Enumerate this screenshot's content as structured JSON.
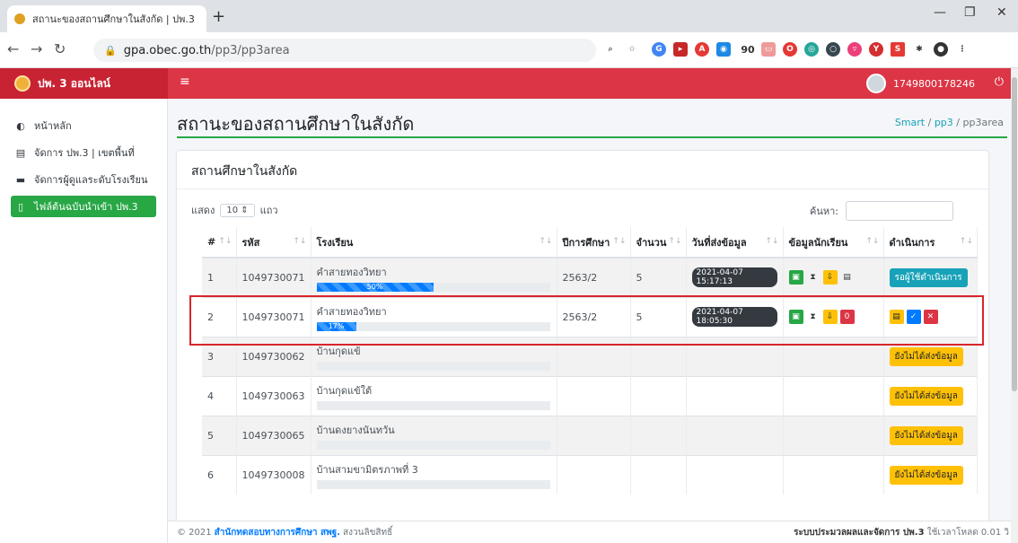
{
  "browser": {
    "tab_title": "สถานะของสถานศึกษาในสังกัด | ปพ.3 ×",
    "url_host": "gpa.obec.go.th",
    "url_path": "/pp3/pp3area",
    "badge_count": "90"
  },
  "header": {
    "brand": "ปพ. 3 ออนไลน์",
    "user_id": "1749800178246"
  },
  "sidebar": {
    "items": [
      {
        "label": "หน้าหลัก"
      },
      {
        "label": "จัดการ ปพ.3 | เขตพื้นที่"
      },
      {
        "label": "จัดการผู้ดูแลระดับโรงเรียน"
      },
      {
        "label": "ไฟล์ต้นฉบับนำเข้า ปพ.3"
      }
    ]
  },
  "page": {
    "title": "สถานะของสถานศึกษาในสังกัด",
    "breadcrumb": [
      "Smart",
      "pp3",
      "pp3area"
    ]
  },
  "card": {
    "title": "สถานศึกษาในสังกัด",
    "length_prefix": "แสดง",
    "length_value": "10",
    "length_suffix": "แถว",
    "search_label": "ค้นหา:"
  },
  "table": {
    "columns": [
      "#",
      "รหัส",
      "โรงเรียน",
      "ปีการศึกษา",
      "จำนวน",
      "วันที่ส่งข้อมูล",
      "ข้อมูลนักเรียน",
      "ดำเนินการ"
    ],
    "rows": [
      {
        "no": "1",
        "code": "1049730071",
        "school": "คำสายทองวิทยา",
        "progress_label": "50%",
        "progress": 0.5,
        "year": "2563/2",
        "count": "5",
        "date": "2021-04-07 15:17:13",
        "action": "รอผู้ใช้ดำเนินการ"
      },
      {
        "no": "2",
        "code": "1049730071",
        "school": "คำสายทองวิทยา",
        "progress_label": "17%",
        "progress": 0.17,
        "year": "2563/2",
        "count": "5",
        "date": "2021-04-07 18:05:30",
        "action": "",
        "count_badge": "0"
      },
      {
        "no": "3",
        "code": "1049730062",
        "school": "บ้านกุดแข้",
        "progress": 0,
        "year": "",
        "count": "",
        "date": "",
        "action": "ยังไม่ได้ส่งข้อมูล"
      },
      {
        "no": "4",
        "code": "1049730063",
        "school": "บ้านกุดแข้ใต้",
        "progress": 0,
        "year": "",
        "count": "",
        "date": "",
        "action": "ยังไม่ได้ส่งข้อมูล"
      },
      {
        "no": "5",
        "code": "1049730065",
        "school": "บ้านดงยางนันทวัน",
        "progress": 0,
        "year": "",
        "count": "",
        "date": "",
        "action": "ยังไม่ได้ส่งข้อมูล"
      },
      {
        "no": "6",
        "code": "1049730008",
        "school": "บ้านสามขามิตรภาพที่ 3",
        "progress": 0,
        "year": "",
        "count": "",
        "date": "",
        "action": "ยังไม่ได้ส่งข้อมูล"
      }
    ]
  },
  "footer": {
    "copyright": "© 2021",
    "org": "สำนักทดสอบทางการศึกษา สพฐ.",
    "rights": "สงวนลิขสิทธิ์",
    "system": "ระบบประมวลผลและจัดการ ปพ.3",
    "load": "ใช้เวลาโหลด 0.01 วิ"
  },
  "colors": {
    "header": "#dc3545",
    "accent": "#28a745",
    "highlight": "#d9252a"
  }
}
